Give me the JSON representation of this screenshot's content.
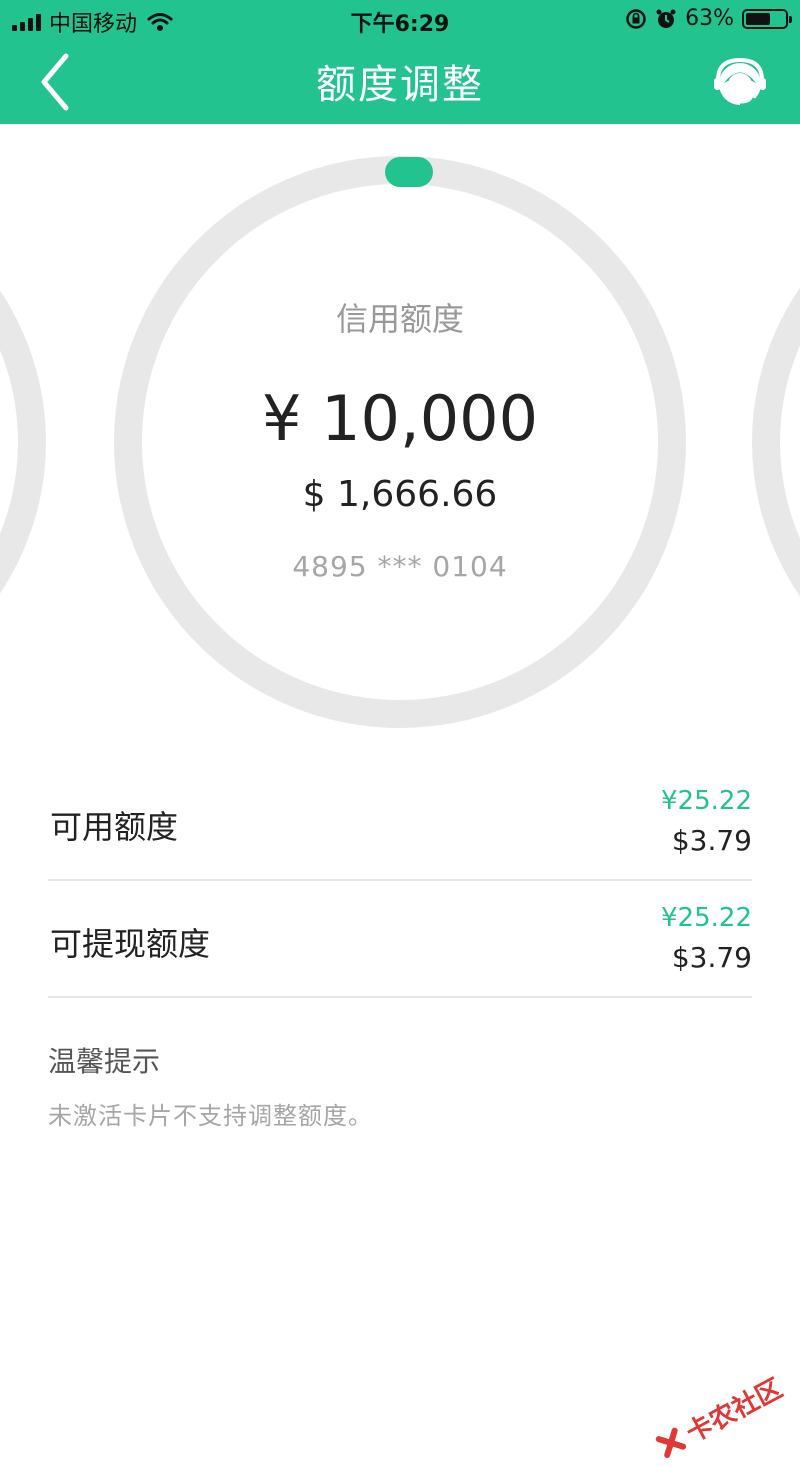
{
  "status_bar": {
    "carrier": "中国移动",
    "time": "下午6:29",
    "battery_pct": "63%",
    "battery_level": 0.63,
    "icons": [
      "signal-icon",
      "wifi-icon",
      "orientation-lock-icon",
      "alarm-icon",
      "battery-icon"
    ]
  },
  "nav": {
    "title": "额度调整",
    "back_icon": "chevron-left-icon",
    "support_icon": "customer-service-icon"
  },
  "gauge": {
    "label": "信用额度",
    "credit_cny": "¥ 10,000",
    "credit_usd": "$ 1,666.66",
    "card_number": "4895 *** 0104",
    "progress_fraction": 0.0
  },
  "rows": [
    {
      "label": "可用额度",
      "cny": "¥25.22",
      "usd": "$3.79"
    },
    {
      "label": "可提现额度",
      "cny": "¥25.22",
      "usd": "$3.79"
    }
  ],
  "tips": {
    "title": "温馨提示",
    "text": "未激活卡片不支持调整额度。"
  },
  "watermark": {
    "text": "卡农社区"
  },
  "colors": {
    "accent": "#22c38e",
    "ring_track": "#e8e8e8",
    "muted_text": "#a6a6a6"
  }
}
